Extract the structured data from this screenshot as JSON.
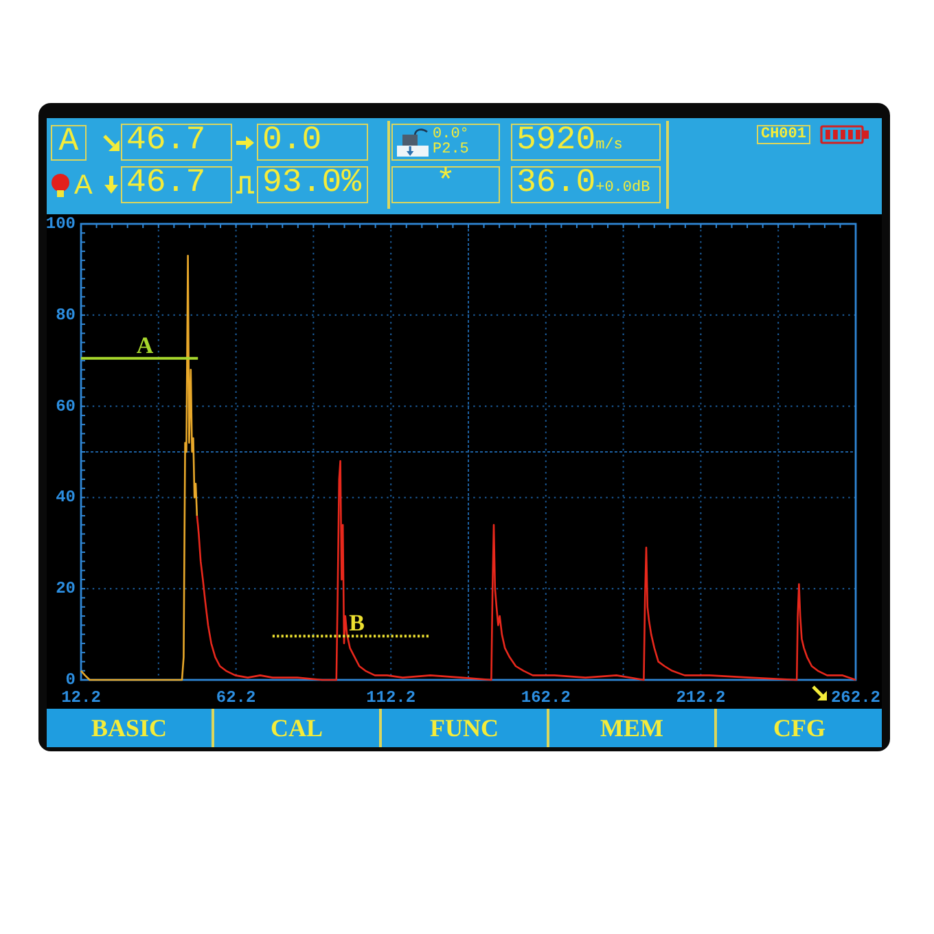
{
  "header": {
    "gate_mode": "A",
    "readings": [
      {
        "kind": "path",
        "value": "46.7"
      },
      {
        "kind": "surface",
        "value": "0.0"
      },
      {
        "kind": "depth",
        "value": "46.7"
      },
      {
        "kind": "amplitude",
        "value": "93.0%"
      }
    ],
    "alarm": {
      "on": true,
      "gate": "A"
    },
    "probe": {
      "angle": "0.0°",
      "frequency": "P2.5"
    },
    "velocity": {
      "value": "5920",
      "unit": "m/s"
    },
    "status_mark": "*",
    "gain": {
      "value": "36.0",
      "step": "+0.0dB"
    },
    "channel": "CH001"
  },
  "screen": {
    "chart_data": {
      "type": "line",
      "xlim": [
        12.2,
        262.2
      ],
      "ylim": [
        0,
        100
      ],
      "xticks": [
        12.2,
        62.2,
        112.2,
        162.2,
        212.2,
        262.2
      ],
      "yticks": [
        0,
        20,
        40,
        60,
        80,
        100
      ],
      "grid": true,
      "x": [
        12.2,
        13.5,
        15,
        30,
        44.8,
        45.3,
        45.8,
        46.2,
        46.7,
        47.1,
        47.6,
        48.0,
        48.4,
        48.8,
        49.2,
        49.6,
        49.9,
        50.2,
        50.8,
        51.5,
        52.3,
        53.2,
        54.2,
        55.5,
        57,
        59,
        62,
        66,
        70,
        74.0,
        82,
        90,
        94.6,
        95.0,
        95.5,
        95.9,
        96.3,
        96.7,
        97.1,
        97.5,
        98.0,
        99,
        100.5,
        102,
        104,
        107,
        111,
        116,
        124.9,
        135,
        144.6,
        145.0,
        145.4,
        145.8,
        146.3,
        146.8,
        147.3,
        148,
        149,
        150.5,
        152.5,
        155,
        158,
        165,
        175,
        185,
        193.8,
        194.2,
        194.6,
        195.0,
        195.5,
        196.2,
        197.2,
        198.5,
        200.5,
        203,
        207,
        215,
        228,
        243.2,
        243.5,
        243.9,
        244.3,
        244.8,
        245.5,
        246.5,
        248,
        250,
        253,
        258,
        262.2
      ],
      "series": [
        {
          "color": "#e8a82a",
          "values": [
            2,
            1,
            0,
            0,
            0,
            5,
            52,
            50,
            93,
            52,
            68,
            50,
            53,
            40,
            43,
            36,
            null,
            null,
            null,
            null,
            null,
            null,
            null,
            null,
            null,
            null,
            null,
            null,
            null,
            null,
            null,
            null,
            null,
            null,
            null,
            null,
            null,
            null,
            null,
            null,
            null,
            null,
            null,
            null,
            null,
            null,
            null,
            null,
            null,
            null,
            null,
            null,
            null,
            null,
            null,
            null,
            null,
            null,
            null,
            null,
            null,
            null,
            null,
            null,
            null,
            null,
            null,
            null,
            null,
            null,
            null,
            null,
            null,
            null,
            null,
            null,
            null,
            null,
            null,
            null,
            null,
            null,
            null,
            null,
            null,
            null,
            null,
            null,
            null,
            null,
            null
          ]
        },
        {
          "color": "#e8281c",
          "values": [
            null,
            null,
            null,
            null,
            null,
            null,
            null,
            null,
            null,
            null,
            null,
            null,
            null,
            null,
            null,
            36,
            34,
            32,
            26,
            22,
            17,
            12,
            8,
            5,
            3,
            2,
            1,
            0.5,
            1,
            0.5,
            0.5,
            0,
            0,
            18,
            44,
            48,
            22,
            34,
            8,
            14,
            10,
            7,
            5,
            3,
            2,
            1,
            1,
            0.5,
            1,
            0.5,
            0,
            20,
            34,
            20,
            16,
            12,
            14,
            10,
            7,
            5,
            3,
            2,
            1,
            1,
            0.5,
            1,
            0,
            18,
            29,
            16,
            13,
            10,
            7,
            4,
            3,
            2,
            1,
            1,
            0.5,
            0,
            14,
            21,
            14,
            9,
            7,
            5,
            3,
            2,
            1,
            1,
            0
          ]
        },
        {
          "name": "A",
          "color": "#a6d62c",
          "values": [
            70.5,
            70.5,
            70.5,
            70.5,
            70.5,
            70.5,
            70.5,
            70.5,
            70.5,
            70.5,
            70.5,
            70.5,
            70.5,
            70.5,
            70.5,
            70.5,
            70.5,
            null,
            null,
            null,
            null,
            null,
            null,
            null,
            null,
            null,
            null,
            null,
            null,
            null,
            null,
            null,
            null,
            null,
            null,
            null,
            null,
            null,
            null,
            null,
            null,
            null,
            null,
            null,
            null,
            null,
            null,
            null,
            null,
            null,
            null,
            null,
            null,
            null,
            null,
            null,
            null,
            null,
            null,
            null,
            null,
            null,
            null,
            null,
            null,
            null,
            null,
            null,
            null,
            null,
            null,
            null,
            null,
            null,
            null,
            null,
            null,
            null,
            null,
            null,
            null,
            null,
            null,
            null,
            null,
            null,
            null,
            null,
            null,
            null,
            null
          ]
        },
        {
          "name": "B",
          "color": "#ecdf30",
          "line_style": "dotted",
          "values": [
            null,
            null,
            null,
            null,
            null,
            null,
            null,
            null,
            null,
            null,
            null,
            null,
            null,
            null,
            null,
            null,
            null,
            null,
            null,
            null,
            null,
            null,
            null,
            null,
            null,
            null,
            null,
            null,
            null,
            9.6,
            9.6,
            9.6,
            9.6,
            9.6,
            9.6,
            9.6,
            9.6,
            9.6,
            9.6,
            9.6,
            9.6,
            9.6,
            9.6,
            9.6,
            9.6,
            9.6,
            9.6,
            9.6,
            9.6,
            null,
            null,
            null,
            null,
            null,
            null,
            null,
            null,
            null,
            null,
            null,
            null,
            null,
            null,
            null,
            null,
            null,
            null,
            null,
            null,
            null,
            null,
            null,
            null,
            null,
            null,
            null,
            null,
            null,
            null,
            null,
            null,
            null,
            null,
            null,
            null,
            null,
            null,
            null,
            null,
            null,
            null
          ]
        }
      ]
    }
  },
  "menu": [
    "BASIC",
    "CAL",
    "FUNC",
    "MEM",
    "CFG"
  ]
}
